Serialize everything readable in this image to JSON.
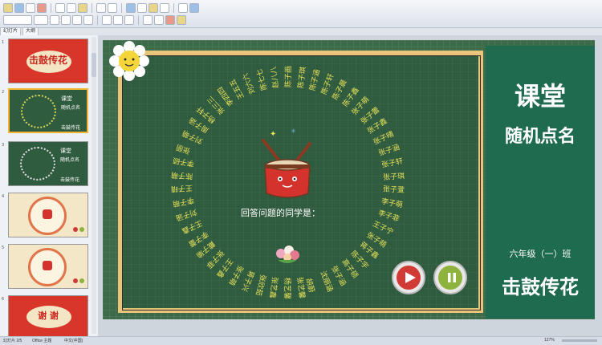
{
  "thumb_tabs": [
    "幻灯片",
    "大纲"
  ],
  "slides_total": 6,
  "selected_slide": 2,
  "thumbnails": [
    {
      "label": "击鼓传花"
    },
    {
      "label1": "课堂",
      "label2": "随机点名",
      "label3": "击鼓传花"
    },
    {
      "label1": "课堂",
      "label2": "随机点名",
      "label3": "击鼓传花"
    },
    {
      "label": ""
    },
    {
      "label": ""
    },
    {
      "label": "谢 谢"
    }
  ],
  "panel": {
    "title_line1": "课堂",
    "title_line2": "随机点名",
    "class_label": "六年级（一）班",
    "game_title": "击鼓传花"
  },
  "board": {
    "prompt": "回答问题的同学是：",
    "names": [
      "陈子画",
      "陈子琪",
      "陈子涵",
      "陈子轩",
      "陈子晨",
      "陈子鑫",
      "张子萌",
      "张子蕾",
      "张子鑫",
      "张子晴",
      "张子涵",
      "张子轩",
      "张子琪",
      "张子萱",
      "李子萌",
      "李子菲",
      "王子宁",
      "张子萌",
      "蒋子鑫",
      "陈子宇",
      "高子硕",
      "张子涵",
      "沈丽涵",
      "胡蔚",
      "张艺馨",
      "杨艺馨",
      "张艺鑫",
      "张欣茹",
      "蒋子兴",
      "张子萌",
      "王子鑫",
      "张子菲",
      "戴子瑜",
      "李子蕾",
      "王子鑫",
      "刘子涵",
      "李子萌",
      "王子晴",
      "陈子萌",
      "李子硕",
      "张丽",
      "刘子萌",
      "周子涵",
      "杨子轩",
      "张三三",
      "李四四",
      "王五五",
      "刘六六",
      "陈七七",
      "赵八八"
    ]
  },
  "controls": {
    "play_color": "#d23b35",
    "pause_color": "#8db33c"
  },
  "status": {
    "slide_text": "幻灯片 2/5",
    "theme": "Office 主题",
    "lang": "中文(中国)",
    "zoom": "127%"
  }
}
